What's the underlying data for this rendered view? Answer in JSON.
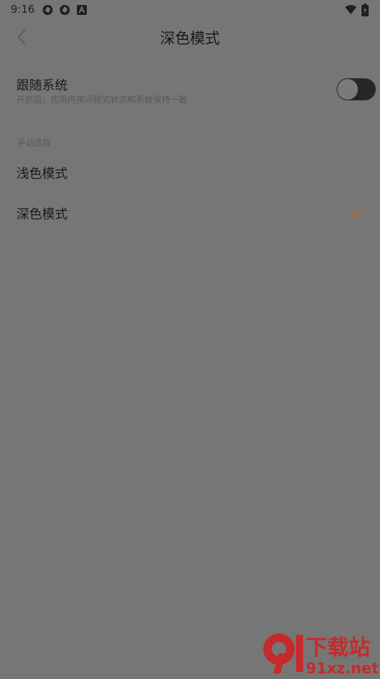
{
  "status_bar": {
    "time": "9:16",
    "icons": [
      "aperture-icon",
      "aperture-icon",
      "font-a-icon",
      "wifi-icon",
      "battery-charging-icon"
    ]
  },
  "header": {
    "title": "深色模式",
    "back_icon": "chevron-left-icon"
  },
  "follow_system": {
    "title": "跟随系统",
    "description": "开启后，应用内夜间模式状态和系统保持一致",
    "enabled": false
  },
  "manual": {
    "section_label": "手动选择",
    "options": [
      {
        "label": "浅色模式",
        "selected": false
      },
      {
        "label": "深色模式",
        "selected": true
      }
    ]
  },
  "watermark": {
    "line1": "下载站",
    "line2": "91xz.net"
  },
  "colors": {
    "background": "#767676",
    "accent": "#b86a2a",
    "toggle_track": "#262626",
    "watermark_red": "#c62a2a"
  }
}
